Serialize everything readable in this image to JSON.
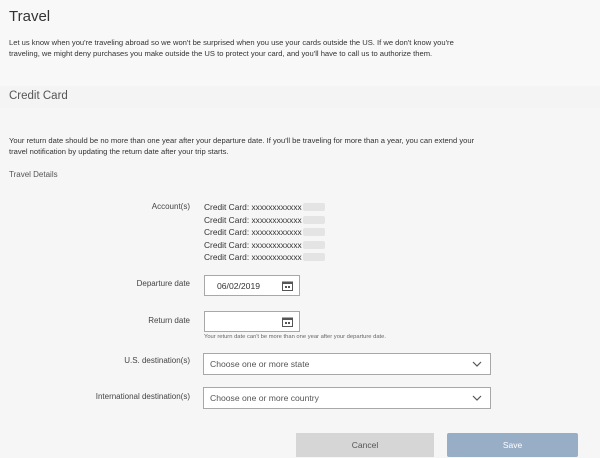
{
  "travel": {
    "title": "Travel",
    "intro": "Let us know when you're traveling abroad so we won't be surprised when you use your cards outside the US. If we don't know you're traveling, we might deny purchases you make outside the US to protect your card, and you'll have to call us to authorize them."
  },
  "credit_card": {
    "title": "Credit Card",
    "return_note": "Your return date should be no more than one year after your departure date. If you'll be traveling for more than a year, you can extend your travel notification by updating the return date after your trip starts."
  },
  "travel_details": {
    "heading": "Travel Details",
    "accounts_label": "Account(s)",
    "accounts": [
      "Credit Card: xxxxxxxxxxxx",
      "Credit Card: xxxxxxxxxxxx",
      "Credit Card: xxxxxxxxxxxx",
      "Credit Card: xxxxxxxxxxxx",
      "Credit Card: xxxxxxxxxxxx"
    ],
    "departure_label": "Departure date",
    "departure_value": "06/02/2019",
    "return_label": "Return date",
    "return_value": "",
    "return_help": "Your return date can't be more than one year after your departure date.",
    "us_dest_label": "U.S. destination(s)",
    "us_dest_placeholder": "Choose one or more state",
    "intl_dest_label": "International destination(s)",
    "intl_dest_placeholder": "Choose one or more country"
  },
  "buttons": {
    "cancel": "Cancel",
    "save": "Save"
  },
  "icons": {
    "calendar": "calendar-icon",
    "chevron": "chevron-down-icon"
  },
  "colors": {
    "save_button": "#98adc6",
    "cancel_button": "#d6d6d6"
  }
}
